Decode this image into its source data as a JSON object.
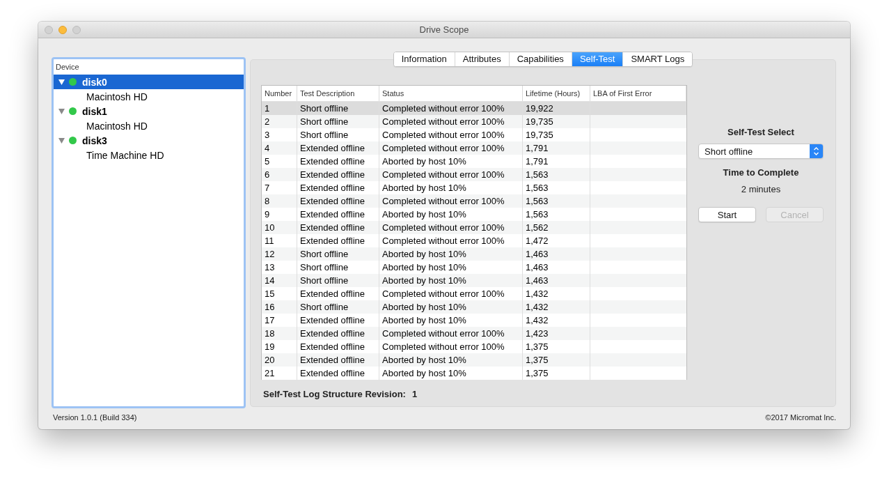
{
  "window": {
    "title": "Drive Scope"
  },
  "device_list": {
    "header": "Device",
    "items": [
      {
        "name": "disk0",
        "selected": true,
        "expanded": true,
        "color": "#32c84a",
        "children": [
          {
            "name": "Macintosh HD"
          }
        ]
      },
      {
        "name": "disk1",
        "selected": false,
        "expanded": true,
        "color": "#32c84a",
        "children": [
          {
            "name": "Macintosh HD"
          }
        ]
      },
      {
        "name": "disk3",
        "selected": false,
        "expanded": true,
        "color": "#32c84a",
        "children": [
          {
            "name": "Time Machine HD"
          }
        ]
      }
    ]
  },
  "tabs": [
    {
      "label": "Information",
      "selected": false
    },
    {
      "label": "Attributes",
      "selected": false
    },
    {
      "label": "Capabilities",
      "selected": false
    },
    {
      "label": "Self-Test",
      "selected": true
    },
    {
      "label": "SMART Logs",
      "selected": false
    }
  ],
  "self_test_table": {
    "columns": [
      "Number",
      "Test Description",
      "Status",
      "Lifetime (Hours)",
      "LBA of First Error"
    ],
    "rows": [
      {
        "cells": [
          "1",
          "Short offline",
          "Completed without error 100%",
          "19,922"
        ],
        "selected": true
      },
      {
        "cells": [
          "2",
          "Short offline",
          "Completed without error 100%",
          "19,735"
        ],
        "selected": false
      },
      {
        "cells": [
          "3",
          "Short offline",
          "Completed without error 100%",
          "19,735"
        ],
        "selected": false
      },
      {
        "cells": [
          "4",
          "Extended offline",
          "Completed without error 100%",
          "1,791"
        ],
        "selected": false
      },
      {
        "cells": [
          "5",
          "Extended offline",
          "Aborted by host 10%",
          "1,791"
        ],
        "selected": false
      },
      {
        "cells": [
          "6",
          "Extended offline",
          "Completed without error 100%",
          "1,563"
        ],
        "selected": false
      },
      {
        "cells": [
          "7",
          "Extended offline",
          "Aborted by host 10%",
          "1,563"
        ],
        "selected": false
      },
      {
        "cells": [
          "8",
          "Extended offline",
          "Completed without error 100%",
          "1,563"
        ],
        "selected": false
      },
      {
        "cells": [
          "9",
          "Extended offline",
          "Aborted by host 10%",
          "1,563"
        ],
        "selected": false
      },
      {
        "cells": [
          "10",
          "Extended offline",
          "Completed without error 100%",
          "1,562"
        ],
        "selected": false
      },
      {
        "cells": [
          "11",
          "Extended offline",
          "Completed without error 100%",
          "1,472"
        ],
        "selected": false
      },
      {
        "cells": [
          "12",
          "Short offline",
          "Aborted by host 10%",
          "1,463"
        ],
        "selected": false
      },
      {
        "cells": [
          "13",
          "Short offline",
          "Aborted by host 10%",
          "1,463"
        ],
        "selected": false
      },
      {
        "cells": [
          "14",
          "Short offline",
          "Aborted by host 10%",
          "1,463"
        ],
        "selected": false
      },
      {
        "cells": [
          "15",
          "Extended offline",
          "Completed without error 100%",
          "1,432"
        ],
        "selected": false
      },
      {
        "cells": [
          "16",
          "Short offline",
          "Aborted by host 10%",
          "1,432"
        ],
        "selected": false
      },
      {
        "cells": [
          "17",
          "Extended offline",
          "Aborted by host 10%",
          "1,432"
        ],
        "selected": false
      },
      {
        "cells": [
          "18",
          "Extended offline",
          "Completed without error 100%",
          "1,423"
        ],
        "selected": false
      },
      {
        "cells": [
          "19",
          "Extended offline",
          "Completed without error 100%",
          "1,375"
        ],
        "selected": false
      },
      {
        "cells": [
          "20",
          "Extended offline",
          "Aborted by host 10%",
          "1,375"
        ],
        "selected": false
      },
      {
        "cells": [
          "21",
          "Extended offline",
          "Aborted by host 10%",
          "1,375"
        ],
        "selected": false
      }
    ]
  },
  "log_revision": {
    "label": "Self-Test Log Structure Revision:",
    "value": "1"
  },
  "self_test_select": {
    "label": "Self-Test Select",
    "value": "Short offline"
  },
  "time_to_complete": {
    "label": "Time to Complete",
    "value": "2 minutes"
  },
  "buttons": [
    {
      "label": "Start",
      "disabled": false
    },
    {
      "label": "Cancel",
      "disabled": true
    }
  ],
  "status_bar": {
    "version": "Version 1.0.1 (Build 334)",
    "copyright": "©2017 Micromat Inc."
  }
}
